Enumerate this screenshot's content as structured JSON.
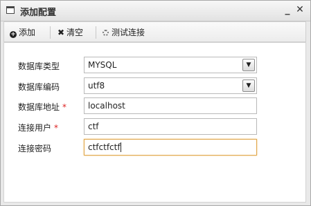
{
  "window": {
    "title": "添加配置",
    "minimize_symbol": "_",
    "close_symbol": "✕"
  },
  "toolbar": {
    "add_label": "添加",
    "add_icon": "plus-circle-icon",
    "clear_label": "清空",
    "clear_icon": "x-icon",
    "test_label": "测试连接",
    "test_icon": "loading-icon"
  },
  "form": {
    "db_type": {
      "label": "数据库类型",
      "value": "MYSQL",
      "required": false
    },
    "db_encoding": {
      "label": "数据库编码",
      "value": "utf8",
      "required": false
    },
    "db_address": {
      "label": "数据库地址",
      "value": "localhost",
      "required": true
    },
    "conn_user": {
      "label": "连接用户",
      "value": "ctf",
      "required": true
    },
    "conn_password": {
      "label": "连接密码",
      "value": "ctfctfctf",
      "required": false,
      "focused": true
    },
    "required_marker": "*"
  },
  "colors": {
    "required": "#dd2222",
    "focus_border": "#e0a64a"
  }
}
